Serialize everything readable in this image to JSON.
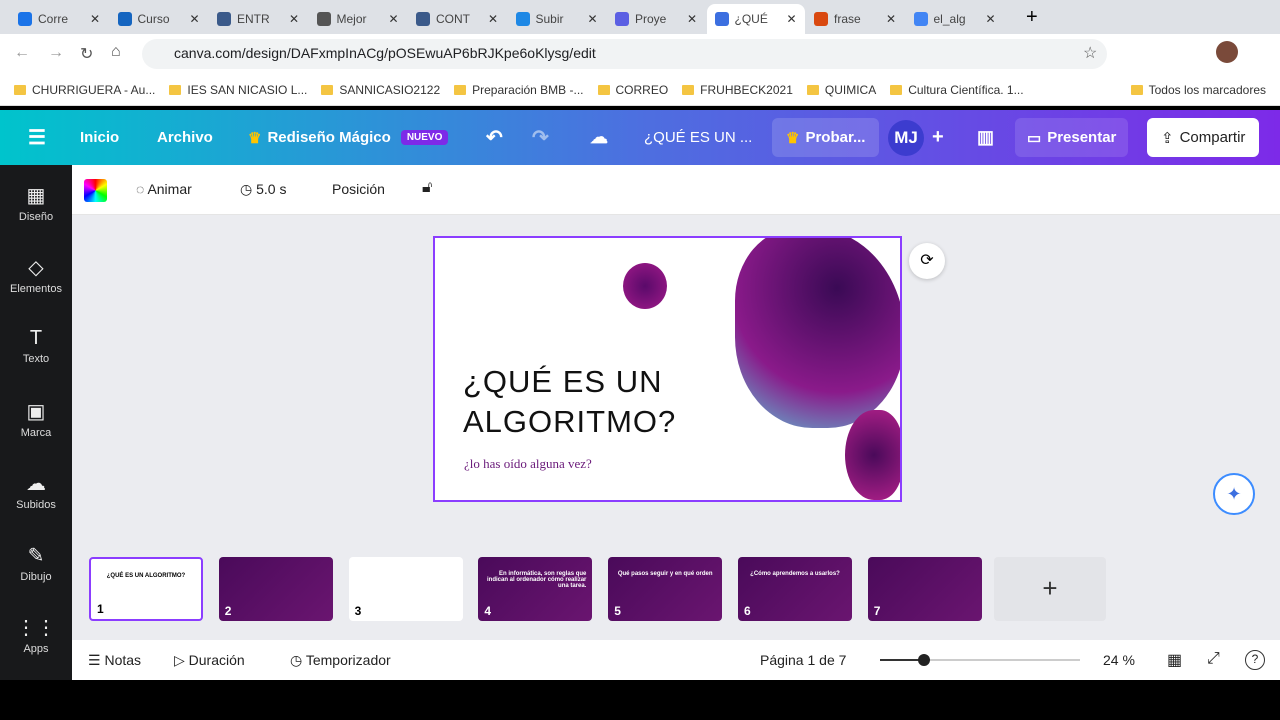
{
  "browser": {
    "tabs": [
      {
        "label": "Corre",
        "color": "#1a73e8"
      },
      {
        "label": "Curso",
        "color": "#1565c0"
      },
      {
        "label": "ENTR",
        "color": "#3b5a8a"
      },
      {
        "label": "Mejor",
        "color": "#555"
      },
      {
        "label": "CONT",
        "color": "#3b5a8a"
      },
      {
        "label": "Subir",
        "color": "#1e88e5"
      },
      {
        "label": "Proye",
        "color": "#5b5fe3"
      },
      {
        "label": "¿QUÉ",
        "color": "#3c6fe0"
      },
      {
        "label": "frase",
        "color": "#d9480f"
      },
      {
        "label": "el_alg",
        "color": "#4285f4"
      }
    ],
    "url": "canva.com/design/DAFxmpInACg/pOSEwuAP6bRJKpe6oKlysg/edit",
    "bookmarks": [
      "CHURRIGUERA - Au...",
      "IES SAN NICASIO L...",
      "SANNICASIO2122",
      "Preparación BMB -...",
      "CORREO",
      "FRUHBECK2021",
      "QUIMICA",
      "Cultura Científica. 1..."
    ],
    "all_bookmarks": "Todos los marcadores"
  },
  "header": {
    "home": "Inicio",
    "file": "Archivo",
    "magic": "Rediseño Mágico",
    "new_badge": "NUEVO",
    "title": "¿QUÉ ES UN ...",
    "try": "Probar...",
    "avatar": "MJ",
    "present": "Presentar",
    "share": "Compartir"
  },
  "sidebar": [
    {
      "label": "Diseño",
      "icon": "layout-icon",
      "g": "▦"
    },
    {
      "label": "Elementos",
      "icon": "elements-icon",
      "g": "◇"
    },
    {
      "label": "Texto",
      "icon": "text-icon",
      "g": "T"
    },
    {
      "label": "Marca",
      "icon": "brand-icon",
      "g": "▣"
    },
    {
      "label": "Subidos",
      "icon": "upload-icon",
      "g": "☁"
    },
    {
      "label": "Dibujo",
      "icon": "draw-icon",
      "g": "✎"
    },
    {
      "label": "Apps",
      "icon": "apps-icon",
      "g": "⋮⋮"
    }
  ],
  "toolbar": {
    "animate": "Animar",
    "duration": "5.0 s",
    "position": "Posición"
  },
  "slide": {
    "title": "¿QUÉ ES UN ALGORITMO?",
    "subtitle": "¿lo has oído alguna vez?"
  },
  "thumbnails": [
    {
      "n": "1",
      "text": "¿QUÉ ES UN ALGORITMO?"
    },
    {
      "n": "2",
      "text": ""
    },
    {
      "n": "3",
      "text": ""
    },
    {
      "n": "4",
      "text": "En informática, son reglas que indican al ordenador cómo realizar una tarea."
    },
    {
      "n": "5",
      "text": "Qué pasos seguir y en qué orden"
    },
    {
      "n": "6",
      "text": "¿Cómo aprendemos a usarlos?"
    },
    {
      "n": "7",
      "text": ""
    }
  ],
  "footer": {
    "notes": "Notas",
    "duration": "Duración",
    "timer": "Temporizador",
    "page": "Página 1 de 7",
    "zoom": "24 %",
    "zoom_fraction": 0.22
  }
}
